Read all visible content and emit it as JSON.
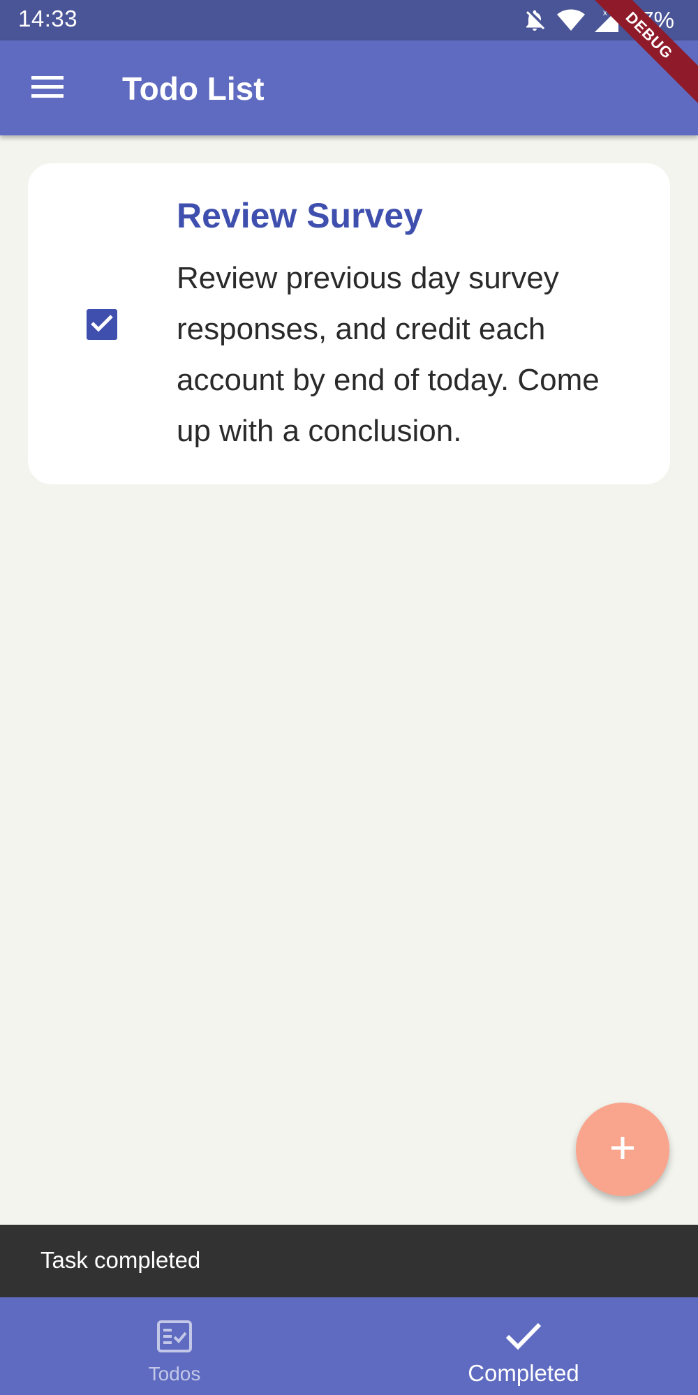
{
  "status_bar": {
    "time": "14:33",
    "battery": "67%",
    "icons": [
      "notifications-off-icon",
      "wifi-icon",
      "signal-icon"
    ]
  },
  "debug_banner": "DEBUG",
  "app_bar": {
    "title": "Todo List",
    "menu_icon": "menu-icon"
  },
  "todo": {
    "title": "Review Survey",
    "description": "Review previous day survey responses, and credit each account by end of today. Come up with a conclusion.",
    "completed": true
  },
  "fab": {
    "icon": "add-icon"
  },
  "snackbar": {
    "message": "Task completed"
  },
  "bottom_nav": {
    "items": [
      {
        "label": "Todos",
        "icon": "checklist-icon",
        "active": false
      },
      {
        "label": "Completed",
        "icon": "check-icon",
        "active": true
      }
    ]
  },
  "colors": {
    "primary": "#5e6bc0",
    "status_bar": "#4a5597",
    "accent": "#3f4fae",
    "fab": "#f9a48d",
    "background": "#f4f4ee",
    "snackbar": "#323232"
  }
}
